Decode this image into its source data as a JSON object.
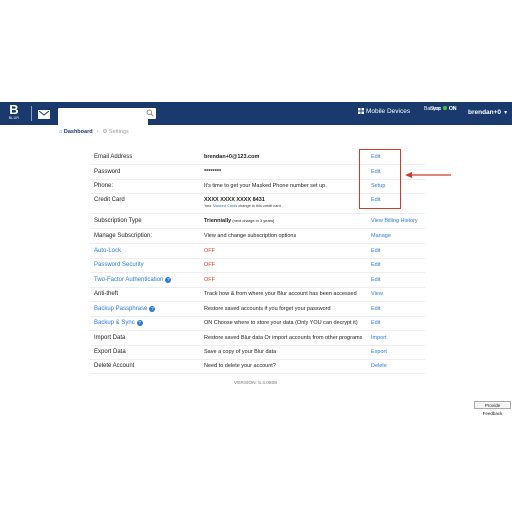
{
  "header": {
    "logo_letter": "B",
    "logo_text": "BLUR",
    "search_placeholder": "",
    "mobile_devices": "Mobile Devices",
    "backup_label": "Backup",
    "backup_state": "ON",
    "sync_label": "Sync",
    "sync_state": "ON",
    "username": "brendan+0",
    "colors": {
      "bar": "#1a3a6e",
      "on_dot": "#3cc43c"
    }
  },
  "breadcrumb": {
    "home": "Dashboard",
    "current": "Settings"
  },
  "settings": [
    {
      "label": "Email Address",
      "desc": "brendan+0@123.com",
      "action": "Edit"
    },
    {
      "label": "Password",
      "desc": "********",
      "action": "Edit"
    },
    {
      "label": "Phone:",
      "desc": "It's time to get your Masked Phone number set up.",
      "action": "Setup"
    },
    {
      "label": "Credit Card",
      "desc": "XXXX XXXX XXXX 8431",
      "desc_pre": "Your ",
      "desc_link": "Masked Cards",
      "desc_post": " change to this credit card",
      "action": "Edit"
    },
    {
      "label": "Subscription Type",
      "desc": "Triennially",
      "desc_extra": " (next charge in 3 years)",
      "action": "View Billing History"
    },
    {
      "label": "Manage Subscription:",
      "desc": "View and change subscription options",
      "action": "Manage"
    },
    {
      "label": "Auto-Lock",
      "desc": "OFF",
      "action": "Edit"
    },
    {
      "label": "Password Security",
      "desc": "OFF",
      "action": "Edit"
    },
    {
      "label": "Two-Factor Authentication",
      "desc": "OFF",
      "action": "Edit"
    },
    {
      "label": "Anti-theft",
      "desc": "Track how & from where your Blur account has been accessed",
      "action": "View"
    },
    {
      "label": "Backup Passphrase",
      "desc": "Restore saved accounts if you forget your password",
      "action": "Edit"
    },
    {
      "label": "Backup & Sync",
      "desc": "ON Choose where to store your data (Only YOU can decrypt it)",
      "action": "Edit"
    },
    {
      "label": "Import Data",
      "desc": "Restore saved Blur data Or import accounts from other programs",
      "action": "Import"
    },
    {
      "label": "Export Data",
      "desc": "Save a copy of your Blur data",
      "action": "Export"
    },
    {
      "label": "Delete Account",
      "desc": "Need to delete your account?",
      "action": "Delete"
    }
  ],
  "version": "VERSION: 5.4.0808",
  "feedback": "Provide Feedback",
  "colors": {
    "link": "#2b7bd2",
    "off": "#e03b24",
    "annotation": "#d23a2a"
  }
}
